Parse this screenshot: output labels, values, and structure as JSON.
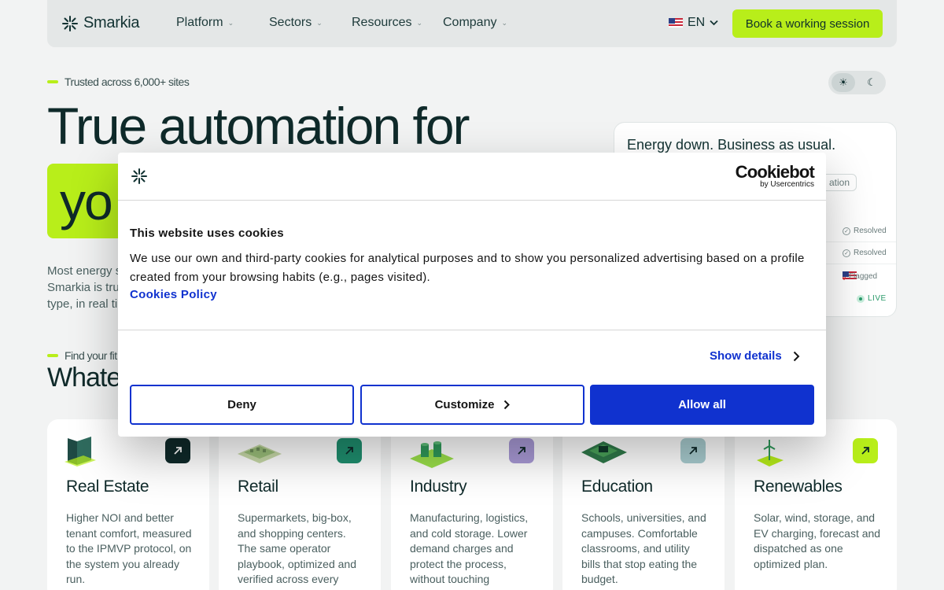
{
  "nav": {
    "logo_text": "Smarkia",
    "items": [
      {
        "label": "Platform"
      },
      {
        "label": "Sectors"
      },
      {
        "label": "Resources"
      },
      {
        "label": "Company"
      }
    ],
    "language": "EN",
    "cta_label": "Book a working session"
  },
  "hero": {
    "eyebrow": "Trusted across 6,000+ sites",
    "headline_line1": "True automation for",
    "headline_highlight": "yo",
    "intro_lines": [
      "Most energy s",
      "Smarkia is tru",
      "type, in real ti"
    ]
  },
  "energy_card": {
    "title": "Energy down. Business as usual.",
    "chip": "ation",
    "rows": [
      {
        "status": "Resolved"
      },
      {
        "status": "Resolved"
      },
      {
        "status": "Flagged"
      }
    ],
    "live": "LIVE"
  },
  "fit_section": {
    "eyebrow": "Find your fit",
    "heading": "Whate"
  },
  "sectors": [
    {
      "title": "Real Estate",
      "description": "Higher NOI and better tenant comfort, measured to the IPMVP protocol, on the system you already run.",
      "arrow_color": "#0f2a2a",
      "arrow_fg": "#ffffff",
      "icon": "building-icon"
    },
    {
      "title": "Retail",
      "description": "Supermarkets, big-box, and shopping centers. The same operator playbook, optimized and verified across every",
      "arrow_color": "#1f8f6f",
      "arrow_fg": "#0f2a2a",
      "icon": "store-icon"
    },
    {
      "title": "Industry",
      "description": "Manufacturing, logistics, and cold storage. Lower demand charges and protect the process, without touching",
      "arrow_color": "#a99ad6",
      "arrow_fg": "#0f2a2a",
      "icon": "factory-icon"
    },
    {
      "title": "Education",
      "description": "Schools, universities, and campuses. Comfortable classrooms, and utility bills that stop eating the budget.",
      "arrow_color": "#a9cdd0",
      "arrow_fg": "#0f2a2a",
      "icon": "school-icon"
    },
    {
      "title": "Renewables",
      "description": "Solar, wind, storage, and EV charging, forecast and dispatched as one optimized plan.",
      "arrow_color": "#b8ee1a",
      "arrow_fg": "#0f2a2a",
      "icon": "wind-turbine-icon"
    }
  ],
  "cookie_dialog": {
    "brand": "Cookiebot",
    "brand_sub": "by Usercentrics",
    "title": "This website uses cookies",
    "body": "We use our own and third-party cookies for analytical purposes and to show you personalized advertising based on a profile created from your browsing habits (e.g., pages visited).",
    "policy_link": "Cookies Policy",
    "show_details": "Show details",
    "deny": "Deny",
    "customize": "Customize",
    "allow_all": "Allow all"
  },
  "colors": {
    "accent": "#b8ee1a",
    "dark": "#0f2a2a",
    "cookie_blue": "#1032cf"
  }
}
